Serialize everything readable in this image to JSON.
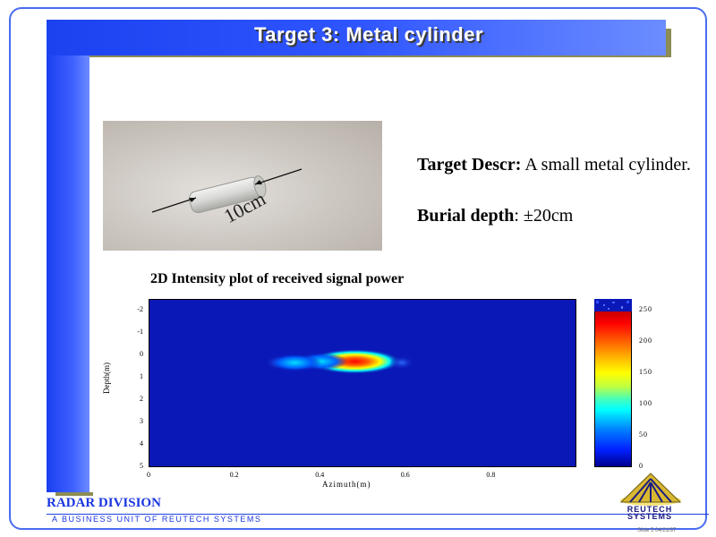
{
  "slide": {
    "title": "Target 3: Metal cylinder",
    "photo_label": "10cm",
    "description_lead": "Target Descr:",
    "description_body": " A small metal cylinder.",
    "depth_lead": "Burial depth",
    "depth_body": ": ±20cm"
  },
  "chart_data": {
    "type": "heatmap",
    "title": "2D Intensity plot of received signal power",
    "xlabel": "Azimuth(m)",
    "ylabel": "Depth(m)",
    "xlim": [
      0,
      1.0
    ],
    "ylim": [
      -2.5,
      5
    ],
    "x_ticks": [
      "0",
      "0.2",
      "0.4",
      "0.6",
      "0.8"
    ],
    "x_tick_values": [
      0,
      0.2,
      0.4,
      0.6,
      0.8
    ],
    "y_ticks": [
      "-2",
      "-1",
      "0",
      "1",
      "2",
      "3",
      "4",
      "5"
    ],
    "y_tick_values": [
      -2,
      -1,
      0,
      1,
      2,
      3,
      4,
      5
    ],
    "colorbar_ticks": [
      "250",
      "200",
      "150",
      "100",
      "50",
      "0"
    ],
    "colorbar_tick_values": [
      250,
      200,
      150,
      100,
      50,
      0
    ],
    "colorbar_range": [
      0,
      260
    ],
    "hotspots": [
      {
        "x": 0.48,
        "y": 0.25,
        "value": 250
      },
      {
        "x": 0.4,
        "y": 0.25,
        "value": 140
      },
      {
        "x": 0.3,
        "y": 0.3,
        "value": 60
      },
      {
        "x": 0.59,
        "y": 0.3,
        "value": 55
      },
      {
        "x": 0.34,
        "y": 0.3,
        "value": 90
      }
    ],
    "grid": false
  },
  "footer": {
    "division": "RADAR DIVISION",
    "subtitle": "A BUSINESS UNIT OF REUTECH SYSTEMS",
    "logo_line1": "REUTECH",
    "logo_line2": "SYSTEMS",
    "slide_no": "Slide 5 04/21/97"
  },
  "colors": {
    "accent_blue": "#1c42f0",
    "shadow_olive": "#8c8c55",
    "footer_blue": "#1a36e0"
  }
}
